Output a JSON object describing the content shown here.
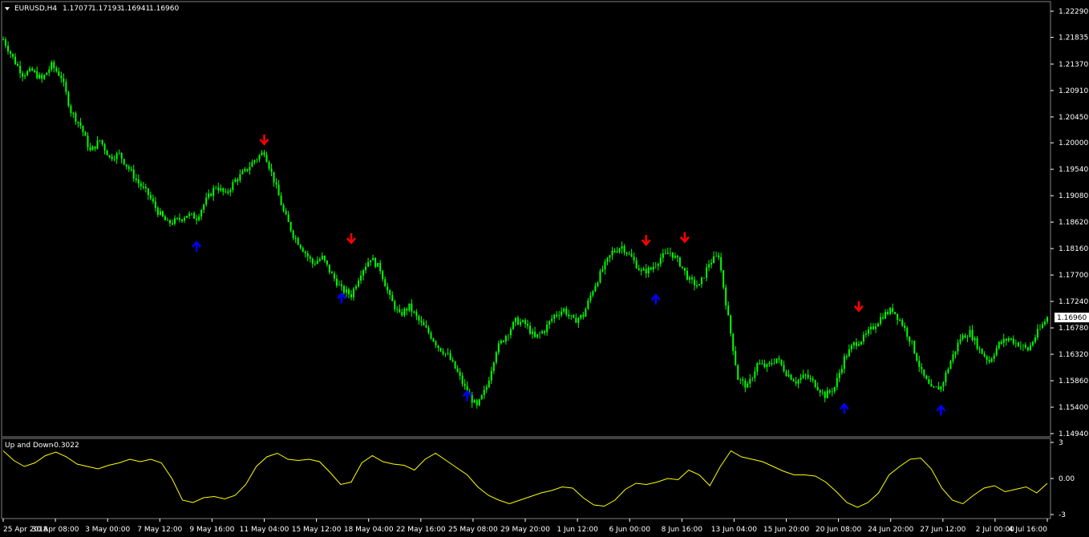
{
  "header": {
    "symbol": "EURUSD,H4",
    "open": "1.17077",
    "high": "1.17193",
    "low": "1.16941",
    "close": "1.16960"
  },
  "indicator": {
    "name": "Up and Down",
    "value": "-0.3022",
    "ticks": [
      "3",
      "0.00",
      "-3"
    ]
  },
  "colors": {
    "background": "#000000",
    "candle": "#00ff00",
    "sell_arrow": "#ff0000",
    "buy_arrow": "#0000ff",
    "indicator_line": "#ffff00",
    "axis": "#ffffff"
  },
  "chart_data": {
    "type": "candlestick",
    "price_axis": {
      "ticks": [
        "1.22290",
        "1.21835",
        "1.21370",
        "1.20910",
        "1.20450",
        "1.20000",
        "1.19540",
        "1.19080",
        "1.18620",
        "1.18160",
        "1.17700",
        "1.17240",
        "1.16780",
        "1.16320",
        "1.15860",
        "1.15400",
        "1.14940"
      ],
      "range": [
        1.1494,
        1.2229
      ],
      "current_price": "1.16960"
    },
    "time_axis": {
      "labels": [
        "25 Apr 2018",
        "30 Apr 08:00",
        "3 May 00:00",
        "7 May 12:00",
        "9 May 16:00",
        "11 May 04:00",
        "15 May 12:00",
        "18 May 04:00",
        "22 May 16:00",
        "25 May 08:00",
        "29 May 20:00",
        "1 Jun 12:00",
        "6 Jun 00:00",
        "8 Jun 16:00",
        "13 Jun 04:00",
        "15 Jun 20:00",
        "20 Jun 08:00",
        "24 Jun 20:00",
        "27 Jun 12:00",
        "2 Jul 00:00",
        "4 Jul 16:00"
      ]
    },
    "close_path": [
      [
        0,
        1.218
      ],
      [
        5,
        1.214
      ],
      [
        8,
        1.212
      ],
      [
        12,
        1.2125
      ],
      [
        16,
        1.211
      ],
      [
        20,
        1.2135
      ],
      [
        24,
        1.2115
      ],
      [
        28,
        1.2055
      ],
      [
        32,
        1.203
      ],
      [
        36,
        1.1985
      ],
      [
        40,
        1.2005
      ],
      [
        44,
        1.1975
      ],
      [
        48,
        1.198
      ],
      [
        52,
        1.1955
      ],
      [
        56,
        1.193
      ],
      [
        60,
        1.191
      ],
      [
        64,
        1.188
      ],
      [
        68,
        1.186
      ],
      [
        72,
        1.1865
      ],
      [
        76,
        1.1875
      ],
      [
        80,
        1.187
      ],
      [
        84,
        1.19
      ],
      [
        88,
        1.1925
      ],
      [
        92,
        1.191
      ],
      [
        96,
        1.1935
      ],
      [
        100,
        1.195
      ],
      [
        104,
        1.197
      ],
      [
        108,
        1.1985
      ],
      [
        112,
        1.1935
      ],
      [
        116,
        1.188
      ],
      [
        120,
        1.184
      ],
      [
        124,
        1.1815
      ],
      [
        128,
        1.179
      ],
      [
        132,
        1.18
      ],
      [
        136,
        1.177
      ],
      [
        140,
        1.1745
      ],
      [
        144,
        1.1735
      ],
      [
        148,
        1.1775
      ],
      [
        152,
        1.18
      ],
      [
        156,
        1.178
      ],
      [
        160,
        1.173
      ],
      [
        164,
        1.17
      ],
      [
        168,
        1.1715
      ],
      [
        172,
        1.169
      ],
      [
        176,
        1.167
      ],
      [
        180,
        1.1645
      ],
      [
        184,
        1.163
      ],
      [
        188,
        1.16
      ],
      [
        192,
        1.1565
      ],
      [
        196,
        1.154
      ],
      [
        200,
        1.1575
      ],
      [
        204,
        1.164
      ],
      [
        208,
        1.1665
      ],
      [
        212,
        1.169
      ],
      [
        216,
        1.1685
      ],
      [
        220,
        1.166
      ],
      [
        224,
        1.1675
      ],
      [
        228,
        1.17
      ],
      [
        232,
        1.171
      ],
      [
        236,
        1.169
      ],
      [
        240,
        1.17
      ],
      [
        244,
        1.1745
      ],
      [
        248,
        1.178
      ],
      [
        252,
        1.181
      ],
      [
        256,
        1.182
      ],
      [
        260,
        1.18
      ],
      [
        264,
        1.1775
      ],
      [
        268,
        1.178
      ],
      [
        272,
        1.18
      ],
      [
        276,
        1.181
      ],
      [
        280,
        1.179
      ],
      [
        284,
        1.176
      ],
      [
        288,
        1.175
      ],
      [
        292,
        1.179
      ],
      [
        296,
        1.1805
      ],
      [
        300,
        1.1695
      ],
      [
        304,
        1.159
      ],
      [
        308,
        1.1575
      ],
      [
        312,
        1.1615
      ],
      [
        316,
        1.161
      ],
      [
        320,
        1.1625
      ],
      [
        324,
        1.16
      ],
      [
        328,
        1.1585
      ],
      [
        332,
        1.1595
      ],
      [
        336,
        1.158
      ],
      [
        340,
        1.156
      ],
      [
        344,
        1.1575
      ],
      [
        348,
        1.1625
      ],
      [
        352,
        1.165
      ],
      [
        356,
        1.166
      ],
      [
        360,
        1.168
      ],
      [
        364,
        1.17
      ],
      [
        368,
        1.171
      ],
      [
        372,
        1.1685
      ],
      [
        376,
        1.165
      ],
      [
        380,
        1.16
      ],
      [
        384,
        1.157
      ],
      [
        388,
        1.1575
      ],
      [
        392,
        1.162
      ],
      [
        396,
        1.166
      ],
      [
        400,
        1.167
      ],
      [
        404,
        1.164
      ],
      [
        408,
        1.162
      ],
      [
        412,
        1.165
      ],
      [
        416,
        1.166
      ],
      [
        420,
        1.165
      ],
      [
        424,
        1.164
      ],
      [
        428,
        1.167
      ],
      [
        432,
        1.1696
      ]
    ],
    "sell_arrows": [
      {
        "i": 108,
        "price": 1.1995
      },
      {
        "i": 144,
        "price": 1.1823
      },
      {
        "i": 266,
        "price": 1.182
      },
      {
        "i": 282,
        "price": 1.1825
      },
      {
        "i": 354,
        "price": 1.1705
      }
    ],
    "buy_arrows": [
      {
        "i": 80,
        "price": 1.183
      },
      {
        "i": 140,
        "price": 1.174
      },
      {
        "i": 192,
        "price": 1.157
      },
      {
        "i": 270,
        "price": 1.1738
      },
      {
        "i": 348,
        "price": 1.1548
      },
      {
        "i": 388,
        "price": 1.1545
      }
    ],
    "indicator_series": [
      [
        0,
        2.3
      ],
      [
        4,
        1.5
      ],
      [
        8,
        1.0
      ],
      [
        12,
        1.3
      ],
      [
        16,
        1.9
      ],
      [
        20,
        2.2
      ],
      [
        24,
        1.8
      ],
      [
        28,
        1.2
      ],
      [
        32,
        1.0
      ],
      [
        36,
        0.8
      ],
      [
        40,
        1.1
      ],
      [
        44,
        1.3
      ],
      [
        48,
        1.6
      ],
      [
        52,
        1.4
      ],
      [
        56,
        1.6
      ],
      [
        60,
        1.3
      ],
      [
        64,
        0.0
      ],
      [
        68,
        -1.8
      ],
      [
        72,
        -2.0
      ],
      [
        76,
        -1.6
      ],
      [
        80,
        -1.5
      ],
      [
        84,
        -1.7
      ],
      [
        88,
        -1.4
      ],
      [
        92,
        -0.5
      ],
      [
        96,
        1.0
      ],
      [
        100,
        1.8
      ],
      [
        104,
        2.1
      ],
      [
        108,
        1.6
      ],
      [
        112,
        1.5
      ],
      [
        116,
        1.6
      ],
      [
        120,
        1.4
      ],
      [
        124,
        0.5
      ],
      [
        128,
        -0.5
      ],
      [
        132,
        -0.3
      ],
      [
        136,
        1.3
      ],
      [
        140,
        1.9
      ],
      [
        144,
        1.4
      ],
      [
        148,
        1.2
      ],
      [
        152,
        1.1
      ],
      [
        156,
        0.7
      ],
      [
        160,
        1.6
      ],
      [
        164,
        2.1
      ],
      [
        168,
        1.5
      ],
      [
        172,
        0.9
      ],
      [
        176,
        0.3
      ],
      [
        180,
        -0.7
      ],
      [
        184,
        -1.4
      ],
      [
        188,
        -1.8
      ],
      [
        192,
        -2.1
      ],
      [
        196,
        -1.8
      ],
      [
        200,
        -1.5
      ],
      [
        204,
        -1.2
      ],
      [
        208,
        -1.0
      ],
      [
        212,
        -0.7
      ],
      [
        216,
        -0.8
      ],
      [
        220,
        -1.6
      ],
      [
        224,
        -2.2
      ],
      [
        228,
        -2.3
      ],
      [
        232,
        -1.8
      ],
      [
        236,
        -0.9
      ],
      [
        240,
        -0.4
      ],
      [
        244,
        -0.5
      ],
      [
        248,
        -0.3
      ],
      [
        252,
        0.0
      ],
      [
        256,
        -0.1
      ],
      [
        260,
        0.7
      ],
      [
        264,
        0.3
      ],
      [
        268,
        -0.6
      ],
      [
        272,
        1.0
      ],
      [
        276,
        2.3
      ],
      [
        280,
        1.8
      ],
      [
        284,
        1.6
      ],
      [
        288,
        1.4
      ],
      [
        292,
        1.0
      ],
      [
        296,
        0.6
      ],
      [
        300,
        0.3
      ],
      [
        304,
        0.3
      ],
      [
        308,
        0.2
      ],
      [
        312,
        -0.3
      ],
      [
        316,
        -1.1
      ],
      [
        320,
        -2.0
      ],
      [
        324,
        -2.4
      ],
      [
        328,
        -2.0
      ],
      [
        332,
        -1.2
      ],
      [
        336,
        0.3
      ],
      [
        340,
        1.0
      ],
      [
        344,
        1.6
      ],
      [
        348,
        1.7
      ],
      [
        352,
        0.8
      ],
      [
        356,
        -0.8
      ],
      [
        360,
        -1.8
      ],
      [
        364,
        -2.1
      ],
      [
        368,
        -1.4
      ],
      [
        372,
        -0.8
      ],
      [
        376,
        -0.6
      ],
      [
        380,
        -1.1
      ],
      [
        384,
        -0.9
      ],
      [
        388,
        -0.7
      ],
      [
        392,
        -1.2
      ],
      [
        396,
        -0.4
      ]
    ],
    "indicator_range": [
      -3,
      3
    ]
  }
}
